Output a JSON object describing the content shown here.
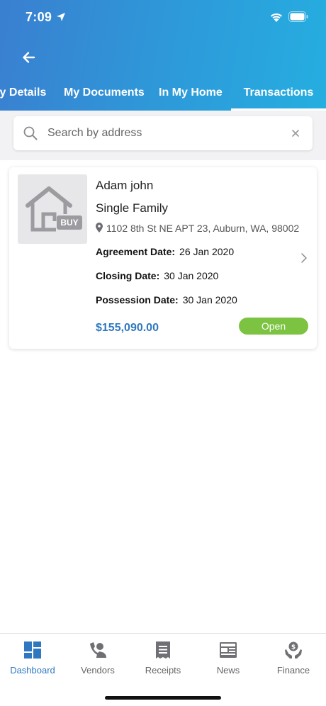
{
  "status_bar": {
    "time": "7:09"
  },
  "header": {
    "tabs": [
      {
        "label": "rty Details"
      },
      {
        "label": "My Documents"
      },
      {
        "label": "In My Home"
      },
      {
        "label": "Transactions",
        "active": true
      }
    ]
  },
  "search": {
    "placeholder": "Search by address",
    "value": ""
  },
  "transaction": {
    "badge": "BUY",
    "name": "Adam john",
    "property_type": "Single Family",
    "address": "1102 8th St NE APT 23, Auburn, WA, 98002",
    "agreement_label": "Agreement Date:",
    "agreement_date": "26 Jan 2020",
    "closing_label": "Closing Date:",
    "closing_date": "30 Jan 2020",
    "possession_label": "Possession Date:",
    "possession_date": "30 Jan 2020",
    "price": "$155,090.00",
    "status": "Open"
  },
  "bottom_nav": {
    "items": [
      {
        "label": "Dashboard",
        "icon": "dashboard-icon",
        "active": true
      },
      {
        "label": "Vendors",
        "icon": "vendors-icon"
      },
      {
        "label": "Receipts",
        "icon": "receipt-icon"
      },
      {
        "label": "News",
        "icon": "news-icon"
      },
      {
        "label": "Finance",
        "icon": "finance-icon"
      }
    ]
  },
  "colors": {
    "header_gradient_start": "#3a7fd0",
    "header_gradient_end": "#25aee0",
    "price": "#2f78c0",
    "status_open": "#7cc341",
    "nav_active": "#2f78c0"
  }
}
